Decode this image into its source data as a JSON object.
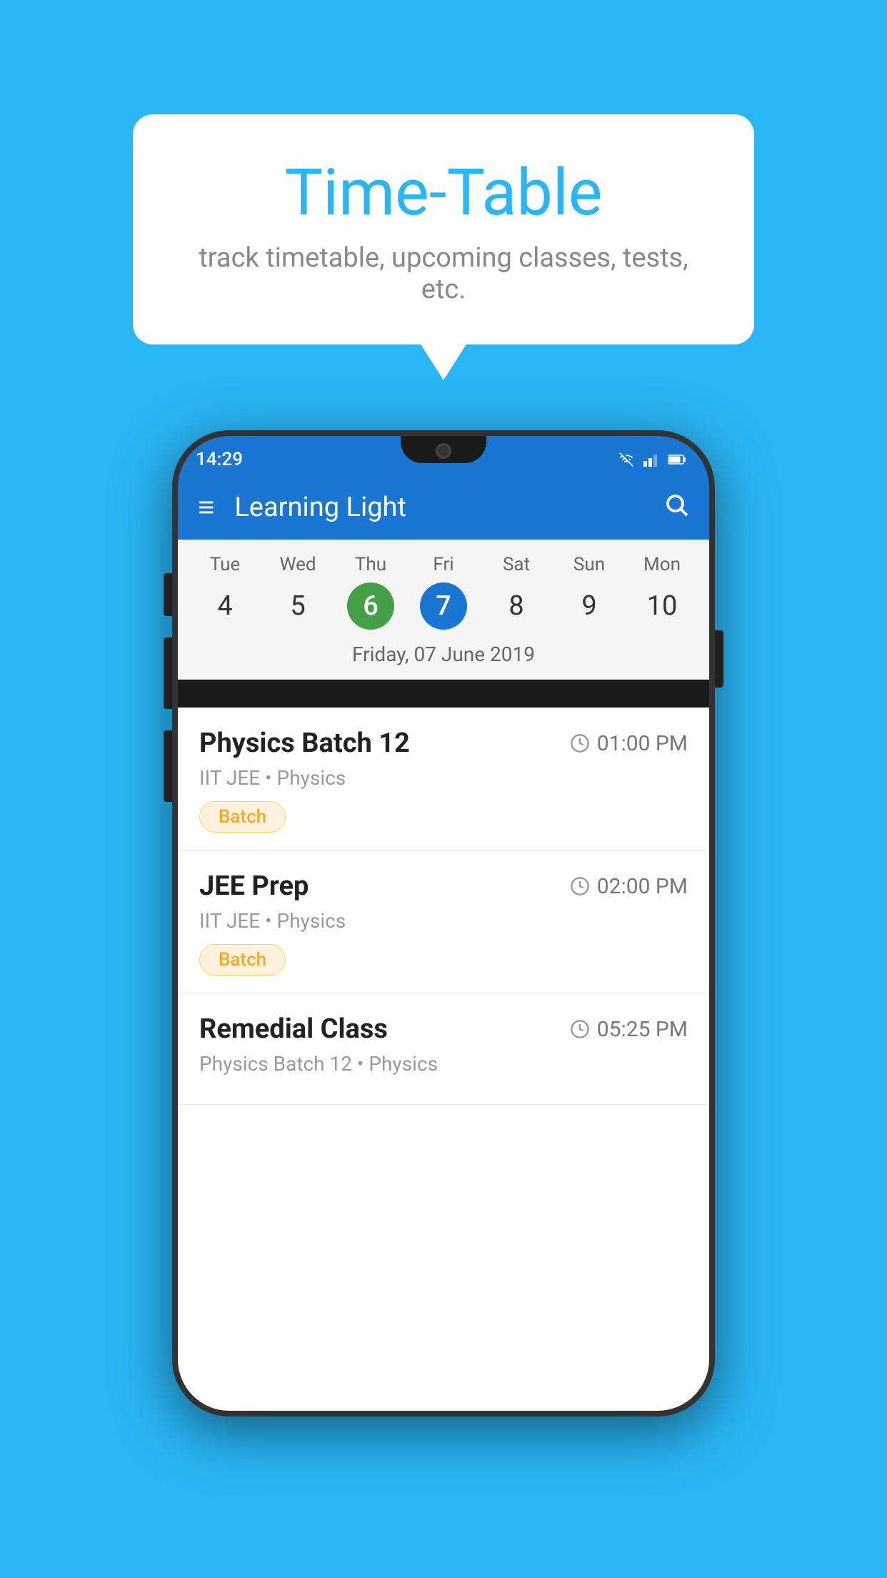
{
  "background_color": "#29B6F6",
  "speech_bubble": {
    "title": "Time-Table",
    "subtitle": "track timetable, upcoming classes, tests, etc."
  },
  "phone": {
    "status_bar": {
      "time": "14:29"
    },
    "app_bar": {
      "title": "Learning Light"
    },
    "calendar": {
      "days": [
        {
          "label": "Tue",
          "num": "4",
          "state": "normal"
        },
        {
          "label": "Wed",
          "num": "5",
          "state": "normal"
        },
        {
          "label": "Thu",
          "num": "6",
          "state": "today"
        },
        {
          "label": "Fri",
          "num": "7",
          "state": "selected"
        },
        {
          "label": "Sat",
          "num": "8",
          "state": "normal"
        },
        {
          "label": "Sun",
          "num": "9",
          "state": "normal"
        },
        {
          "label": "Mon",
          "num": "10",
          "state": "normal"
        }
      ],
      "selected_date_label": "Friday, 07 June 2019"
    },
    "schedule_items": [
      {
        "title": "Physics Batch 12",
        "time": "01:00 PM",
        "subtitle": "IIT JEE • Physics",
        "badge": "Batch"
      },
      {
        "title": "JEE Prep",
        "time": "02:00 PM",
        "subtitle": "IIT JEE • Physics",
        "badge": "Batch"
      },
      {
        "title": "Remedial Class",
        "time": "05:25 PM",
        "subtitle": "Physics Batch 12 • Physics",
        "badge": null
      }
    ]
  },
  "icons": {
    "hamburger": "≡",
    "search": "🔍",
    "clock": "🕐"
  }
}
